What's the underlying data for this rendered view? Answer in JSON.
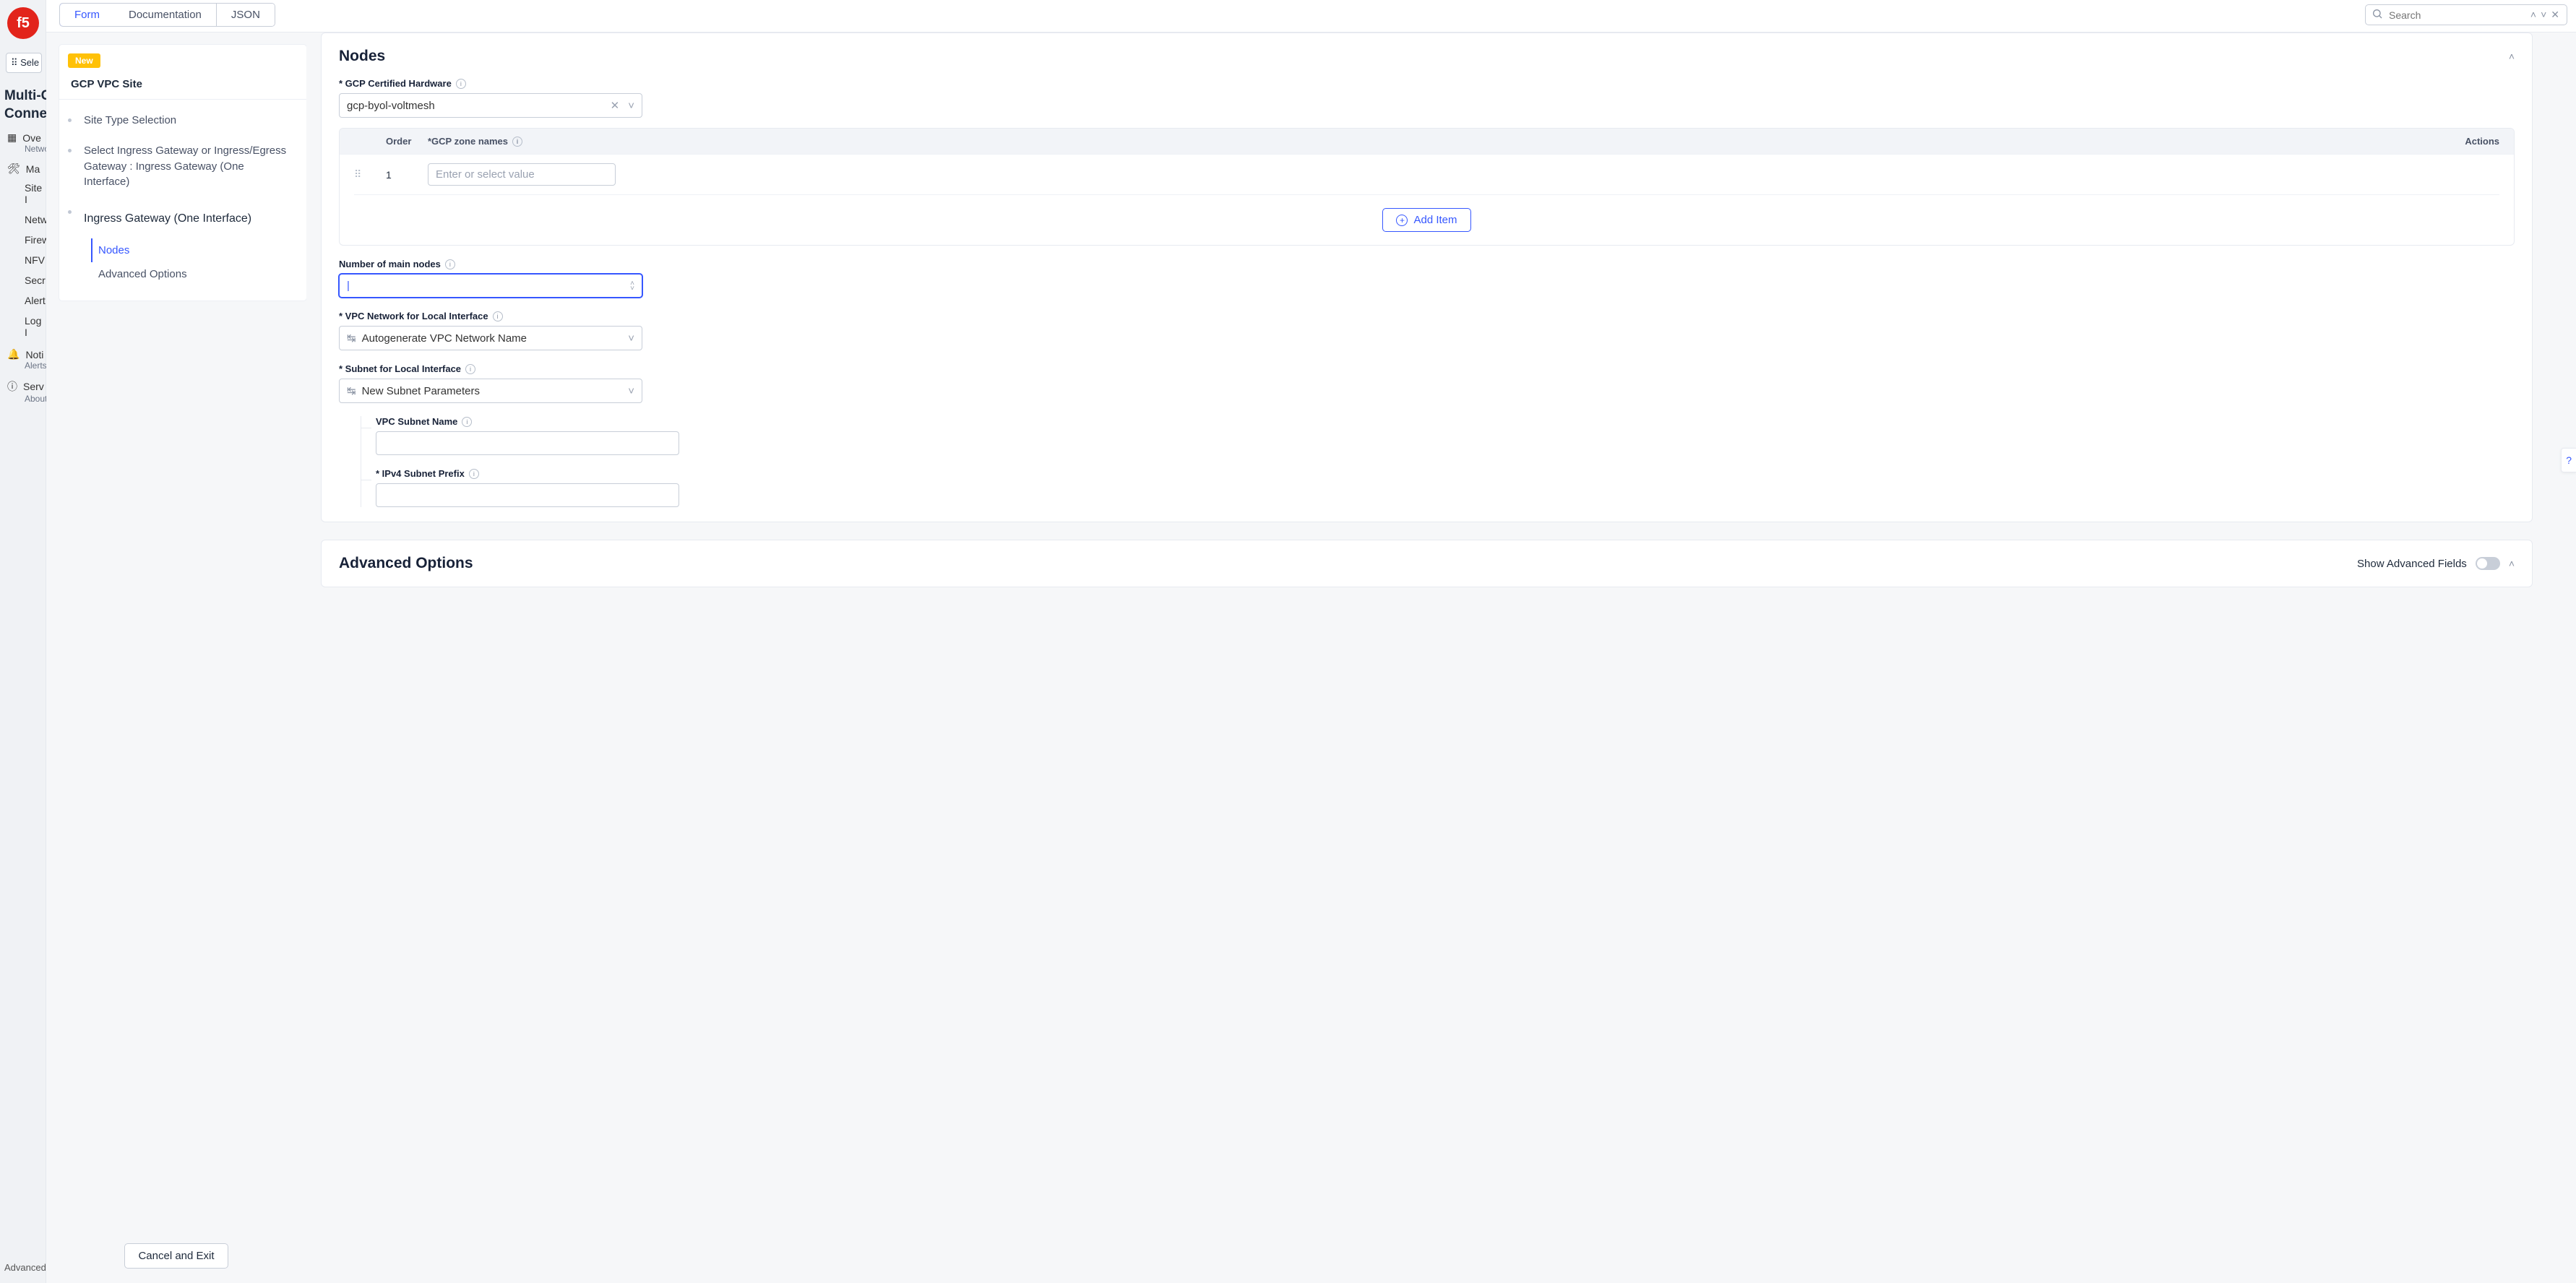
{
  "bg": {
    "select": "Sele",
    "heading1": "Multi-C",
    "heading2": "Connec",
    "items": [
      "Ove",
      "Ma",
      "Site I",
      "Netw",
      "Firew",
      "NFV",
      "Secr",
      "Alert",
      "Log I",
      "Noti",
      "Serv"
    ],
    "netw_sub": "Netwo",
    "alerts_sub": "Alerts",
    "about_sub": "About",
    "advanced": "Advanced"
  },
  "tabs": {
    "form": "Form",
    "documentation": "Documentation",
    "json": "JSON"
  },
  "search": {
    "placeholder": "Search"
  },
  "nav": {
    "badge": "New",
    "title": "GCP VPC Site",
    "items": [
      "Site Type Selection",
      "Select Ingress Gateway or Ingress/Egress Gateway : Ingress Gateway (One Interface)"
    ],
    "section": "Ingress Gateway (One Interface)",
    "sub": {
      "nodes": "Nodes",
      "advanced": "Advanced Options"
    },
    "cancel": "Cancel and Exit"
  },
  "form": {
    "nodes_title": "Nodes",
    "gcp_hw_label": "* GCP Certified Hardware",
    "gcp_hw_value": "gcp-byol-voltmesh",
    "zone_order_hdr": "Order",
    "zone_name_hdr": "*GCP zone names",
    "zone_actions_hdr": "Actions",
    "zone_row_order": "1",
    "zone_input_placeholder": "Enter or select value",
    "add_item": "Add Item",
    "num_nodes_label": "Number of main nodes",
    "vpc_net_label": "* VPC Network for Local Interface",
    "vpc_net_value": "Autogenerate VPC Network Name",
    "subnet_label": "* Subnet for Local Interface",
    "subnet_value": "New Subnet Parameters",
    "vpc_subnet_name_label": "VPC Subnet Name",
    "ipv4_prefix_label": "* IPv4 Subnet Prefix",
    "adv_title": "Advanced Options",
    "show_adv": "Show Advanced Fields"
  }
}
